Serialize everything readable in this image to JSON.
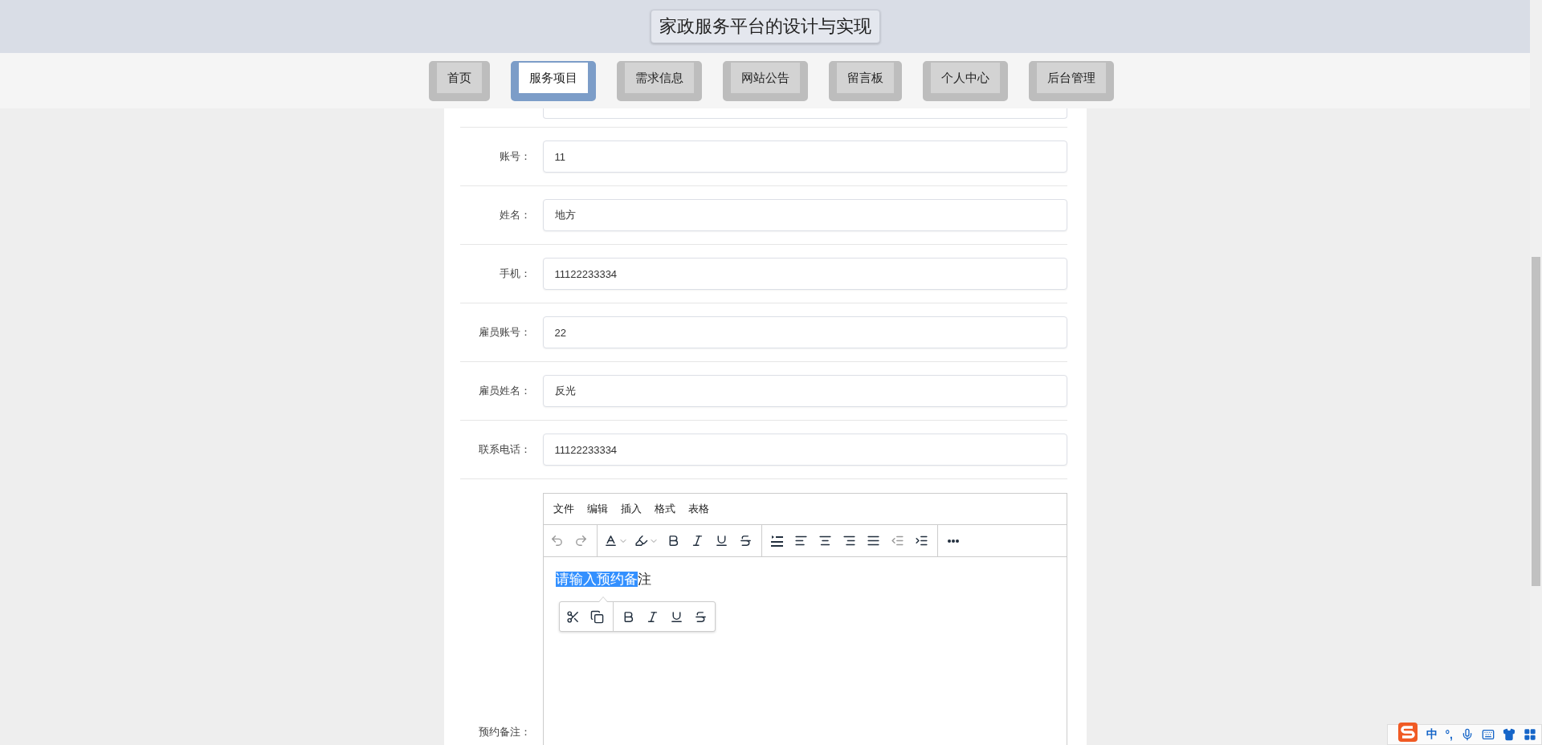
{
  "header": {
    "title": "家政服务平台的设计与实现"
  },
  "nav": [
    {
      "label": "首页",
      "selected": false
    },
    {
      "label": "服务项目",
      "selected": true
    },
    {
      "label": "需求信息",
      "selected": false
    },
    {
      "label": "网站公告",
      "selected": false
    },
    {
      "label": "留言板",
      "selected": false
    },
    {
      "label": "个人中心",
      "selected": false
    },
    {
      "label": "后台管理",
      "selected": false
    }
  ],
  "form": {
    "fields": [
      {
        "label": "账号：",
        "value": "11"
      },
      {
        "label": "姓名：",
        "value": "地方"
      },
      {
        "label": "手机：",
        "value": "11122233334"
      },
      {
        "label": "雇员账号：",
        "value": "22"
      },
      {
        "label": "雇员姓名：",
        "value": "反光"
      },
      {
        "label": "联系电话：",
        "value": "11122233334"
      }
    ],
    "editor": {
      "label": "预约备注：",
      "menu": [
        "文件",
        "编辑",
        "插入",
        "格式",
        "表格"
      ],
      "toolbar": [
        {
          "kind": "undo",
          "disabled": true
        },
        {
          "kind": "redo",
          "disabled": true
        },
        {
          "kind": "sep"
        },
        {
          "kind": "forecolor",
          "disabled": false
        },
        {
          "kind": "backcolor",
          "disabled": false
        },
        {
          "kind": "bold",
          "disabled": false
        },
        {
          "kind": "italic",
          "disabled": false
        },
        {
          "kind": "underline",
          "disabled": false
        },
        {
          "kind": "strike",
          "disabled": false
        },
        {
          "kind": "sep"
        },
        {
          "kind": "lineheight",
          "disabled": false
        },
        {
          "kind": "alignleft",
          "disabled": false
        },
        {
          "kind": "aligncenter",
          "disabled": false
        },
        {
          "kind": "alignright",
          "disabled": false
        },
        {
          "kind": "justify",
          "disabled": false
        },
        {
          "kind": "outdent",
          "disabled": true
        },
        {
          "kind": "indent",
          "disabled": false
        },
        {
          "kind": "sep"
        },
        {
          "kind": "more",
          "disabled": false
        }
      ],
      "selected_text": "请输入预约备",
      "text": "注",
      "quickbar": [
        {
          "kind": "cut"
        },
        {
          "kind": "copy"
        },
        {
          "kind": "sep"
        },
        {
          "kind": "bold"
        },
        {
          "kind": "italic"
        },
        {
          "kind": "underline"
        },
        {
          "kind": "strike"
        }
      ]
    }
  },
  "ime": {
    "mode": "中",
    "punctuation": "°,"
  }
}
